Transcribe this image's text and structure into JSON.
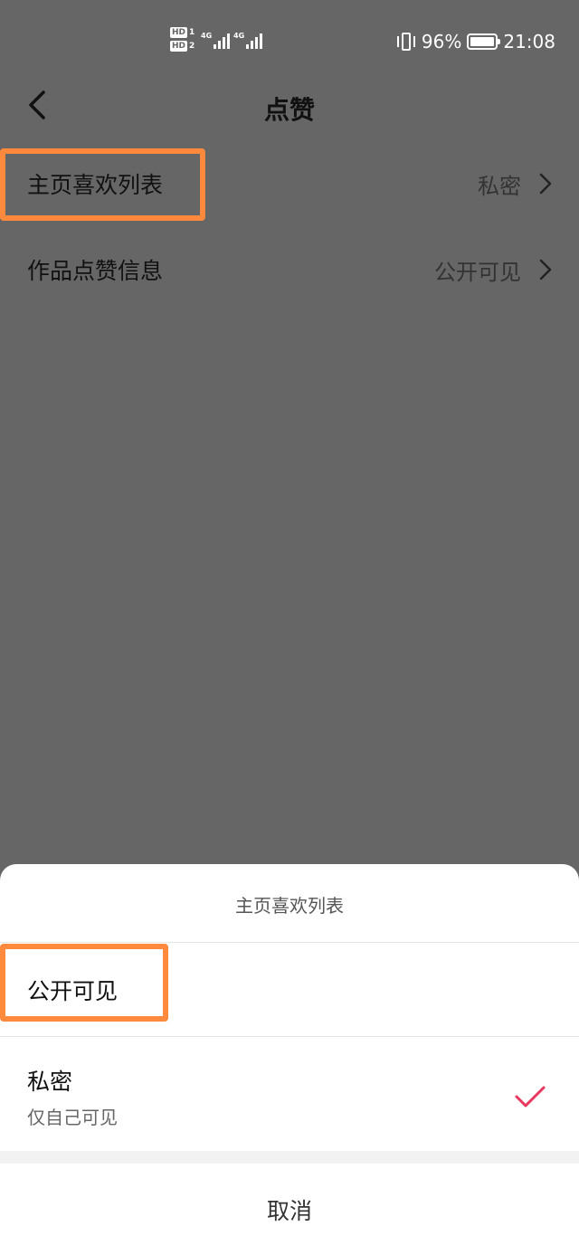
{
  "status_bar": {
    "sim1_badge": "HD",
    "sim1_num": "1",
    "sim2_badge": "HD",
    "sim2_num": "2",
    "network1": "4G",
    "network2": "4G",
    "battery_percent": "96%",
    "time": "21:08"
  },
  "header": {
    "title": "点赞",
    "back_icon": "chevron-left-icon"
  },
  "settings": [
    {
      "label": "主页喜欢列表",
      "value": "私密"
    },
    {
      "label": "作品点赞信息",
      "value": "公开可见"
    }
  ],
  "sheet": {
    "title": "主页喜欢列表",
    "options": [
      {
        "label": "公开可见",
        "description": "",
        "selected": false
      },
      {
        "label": "私密",
        "description": "仅自己可见",
        "selected": true
      }
    ],
    "cancel_label": "取消"
  },
  "colors": {
    "overlay": "#666666",
    "highlight": "#FF8A3D",
    "check": "#E8365D"
  }
}
